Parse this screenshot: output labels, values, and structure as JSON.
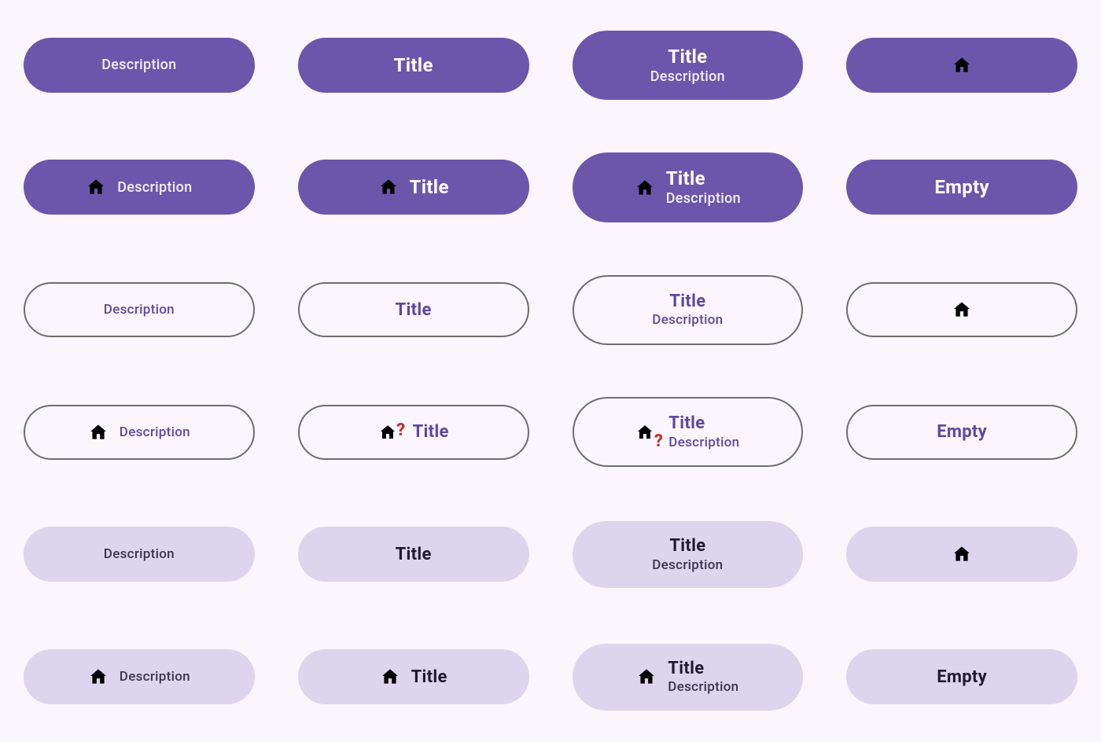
{
  "labels": {
    "title": "Title",
    "description": "Description",
    "empty": "Empty"
  },
  "overlay_glyph": "?",
  "colors": {
    "filled_bg": "#6b56ac",
    "outlined_border": "#6e6e6e",
    "outlined_text": "#5a49a0",
    "tonal_bg": "#ddd4ee",
    "overlay_red": "#c4322a",
    "page_bg": "#fbf5fd"
  },
  "rows": [
    {
      "style": "filled",
      "icon": false,
      "cells": [
        "desc",
        "title",
        "title+desc",
        "icon"
      ]
    },
    {
      "style": "filled",
      "icon": true,
      "cells": [
        "icon+desc",
        "icon+title",
        "icon+title+desc",
        "empty"
      ]
    },
    {
      "style": "outlined",
      "icon": false,
      "cells": [
        "desc",
        "title",
        "title+desc",
        "icon"
      ]
    },
    {
      "style": "outlined",
      "icon": true,
      "overlay": true,
      "cells": [
        "icon+desc",
        "icon!+title",
        "icon!+title+desc",
        "empty"
      ]
    },
    {
      "style": "tonal",
      "icon": false,
      "cells": [
        "desc",
        "title",
        "title+desc",
        "icon"
      ]
    },
    {
      "style": "tonal",
      "icon": true,
      "cells": [
        "icon+desc",
        "icon+title",
        "icon+title+desc",
        "empty"
      ]
    }
  ]
}
